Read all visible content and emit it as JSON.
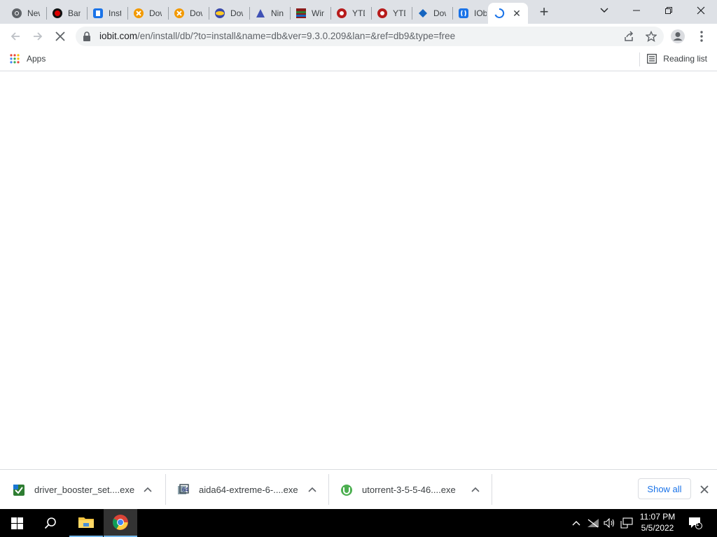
{
  "browser": {
    "tabs": [
      {
        "title": "New Tab",
        "icon": "chrome-icon",
        "color": "#5f6368"
      },
      {
        "title": "Bandicam",
        "icon": "bandicam-icon",
        "color": "#c00000"
      },
      {
        "title": "Install",
        "icon": "installer-icon",
        "color": "#1a73e8"
      },
      {
        "title": "Download",
        "icon": "download-site-icon",
        "color": "#f29900"
      },
      {
        "title": "Download",
        "icon": "download-site-icon",
        "color": "#f29900"
      },
      {
        "title": "Download",
        "icon": "download-globe-icon",
        "color": "#3949ab"
      },
      {
        "title": "Ninite",
        "icon": "ninite-icon",
        "color": "#3f51b5"
      },
      {
        "title": "WinRAR",
        "icon": "winrar-icon",
        "color": "#8b1a1a"
      },
      {
        "title": "YTD",
        "icon": "ytd-icon",
        "color": "#b71c1c"
      },
      {
        "title": "YTD",
        "icon": "ytd-icon",
        "color": "#b71c1c"
      },
      {
        "title": "Download",
        "icon": "download-arrow-icon",
        "color": "#1565c0"
      },
      {
        "title": "IObit",
        "icon": "iobit-icon",
        "color": "#1a73e8"
      }
    ],
    "active_tab": {
      "title": "",
      "loading": true
    },
    "url_host": "iobit.com",
    "url_path": "/en/install/db/?to=install&name=db&ver=9.3.0.209&lan=&ref=db9&type=free"
  },
  "bookmarks": {
    "apps_label": "Apps",
    "reading_list_label": "Reading list"
  },
  "downloads": {
    "items": [
      {
        "name": "driver_booster_set....exe",
        "icon": "driver-booster-icon"
      },
      {
        "name": "aida64-extreme-6-....exe",
        "icon": "aida64-icon"
      },
      {
        "name": "utorrent-3-5-5-46....exe",
        "icon": "utorrent-icon"
      }
    ],
    "show_all_label": "Show all"
  },
  "taskbar": {
    "time": "11:07 PM",
    "date": "5/5/2022",
    "notifications_count": "1"
  }
}
